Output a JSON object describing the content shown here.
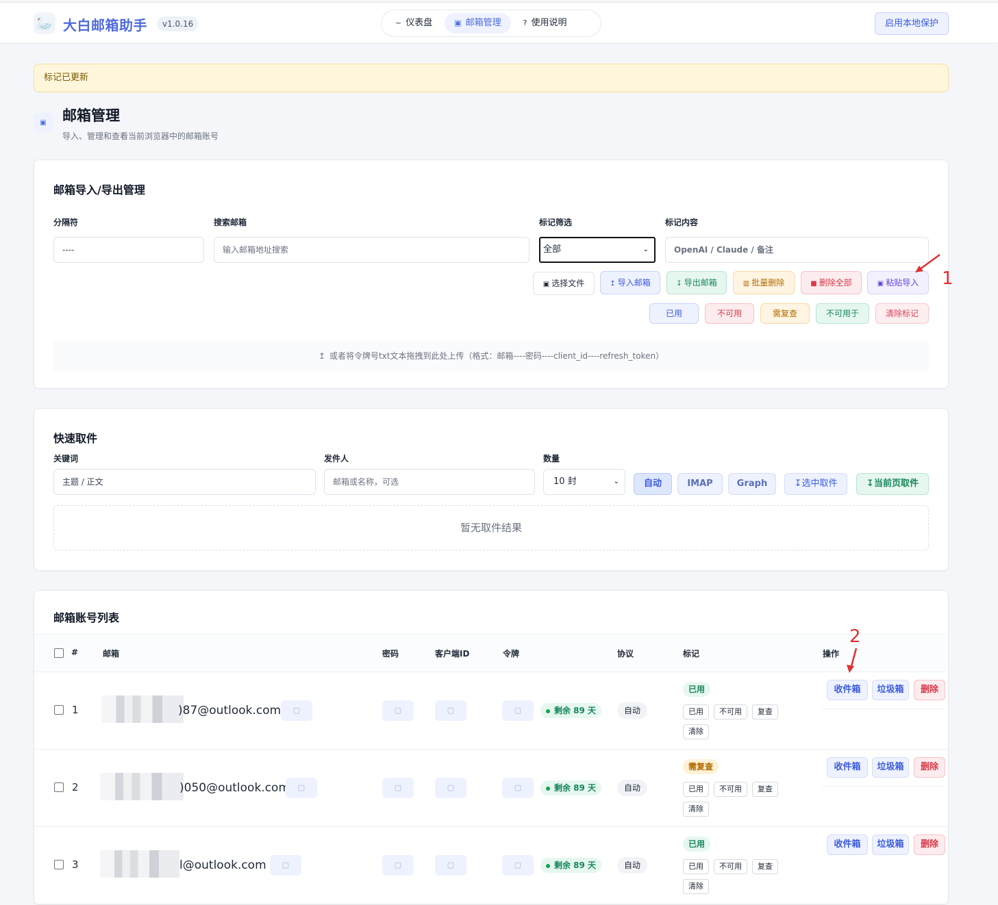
{
  "app": {
    "logo_icon": "swan-logo-icon",
    "title": "大白邮箱助手",
    "version": "v1.0.16",
    "nav": [
      {
        "icon": "~",
        "label": "仪表盘"
      },
      {
        "icon": "▣",
        "label": "邮箱管理"
      },
      {
        "icon": "?",
        "label": "使用说明"
      }
    ],
    "protect_label": "启用本地保护"
  },
  "alert": {
    "text": "标记已更新"
  },
  "page": {
    "title": "邮箱管理",
    "subtitle": "导入、管理和查看当前浏览器中的邮箱账号"
  },
  "import_card": {
    "title": "邮箱导入/导出管理",
    "separator_label": "分隔符",
    "separator_value": "----",
    "search_label": "搜索邮箱",
    "search_placeholder": "输入邮箱地址搜索",
    "filter_label": "标记筛选",
    "filter_value": "全部",
    "mark_content_label": "标记内容",
    "mark_content_placeholder": "OpenAI / Claude / 备注",
    "buttons": {
      "choose_file": "选择文件",
      "import": "导入邮箱",
      "export": "导出邮箱",
      "batch_delete": "批量删除",
      "delete_all": "删除全部",
      "paste_import": "粘贴导入"
    },
    "mark_buttons": {
      "used": "已用",
      "unusable": "不可用",
      "recheck": "需复查",
      "not_for": "不可用于",
      "clear": "清除标记"
    },
    "dropzone_text": "或者将令牌号txt文本拖拽到此处上传（格式：邮箱----密码----client_id----refresh_token）"
  },
  "quick_fetch": {
    "title": "快速取件",
    "keyword_label": "关键词",
    "keyword_placeholder": "主题 / 正文",
    "sender_label": "发件人",
    "sender_placeholder": "邮箱或名称，可选",
    "count_label": "数量",
    "count_value": "10 封",
    "modes": {
      "auto": "自动",
      "imap": "IMAP",
      "graph": "Graph"
    },
    "fetch_selected": "选中取件",
    "fetch_page": "当前页取件",
    "empty_text": "暂无取件结果"
  },
  "accounts": {
    "title": "邮箱账号列表",
    "columns": {
      "index": "#",
      "email": "邮箱",
      "password": "密码",
      "client_id": "客户端ID",
      "token": "令牌",
      "protocol": "协议",
      "mark": "标记",
      "actions": "操作"
    },
    "mini_labels": {
      "used": "已用",
      "unusable": "不可用",
      "recheck": "复查",
      "clear": "清除"
    },
    "action_labels": {
      "inbox": "收件箱",
      "junk": "垃圾箱",
      "delete": "删除"
    },
    "rows": [
      {
        "index": "1",
        "email_visible": ")87@outlook.com",
        "token_status": "剩余 89 天",
        "protocol": "自动",
        "mark": "已用",
        "mark_color": "#16875a"
      },
      {
        "index": "2",
        "email_visible": ")050@outlook.com",
        "token_status": "剩余 89 天",
        "protocol": "自动",
        "mark": "需复查",
        "mark_color": "#b26a00"
      },
      {
        "index": "3",
        "email_visible": "l@outlook.com",
        "token_status": "剩余 89 天",
        "protocol": "自动",
        "mark": "已用",
        "mark_color": "#16875a"
      }
    ]
  },
  "annotations": {
    "one": "1",
    "two": "2"
  }
}
